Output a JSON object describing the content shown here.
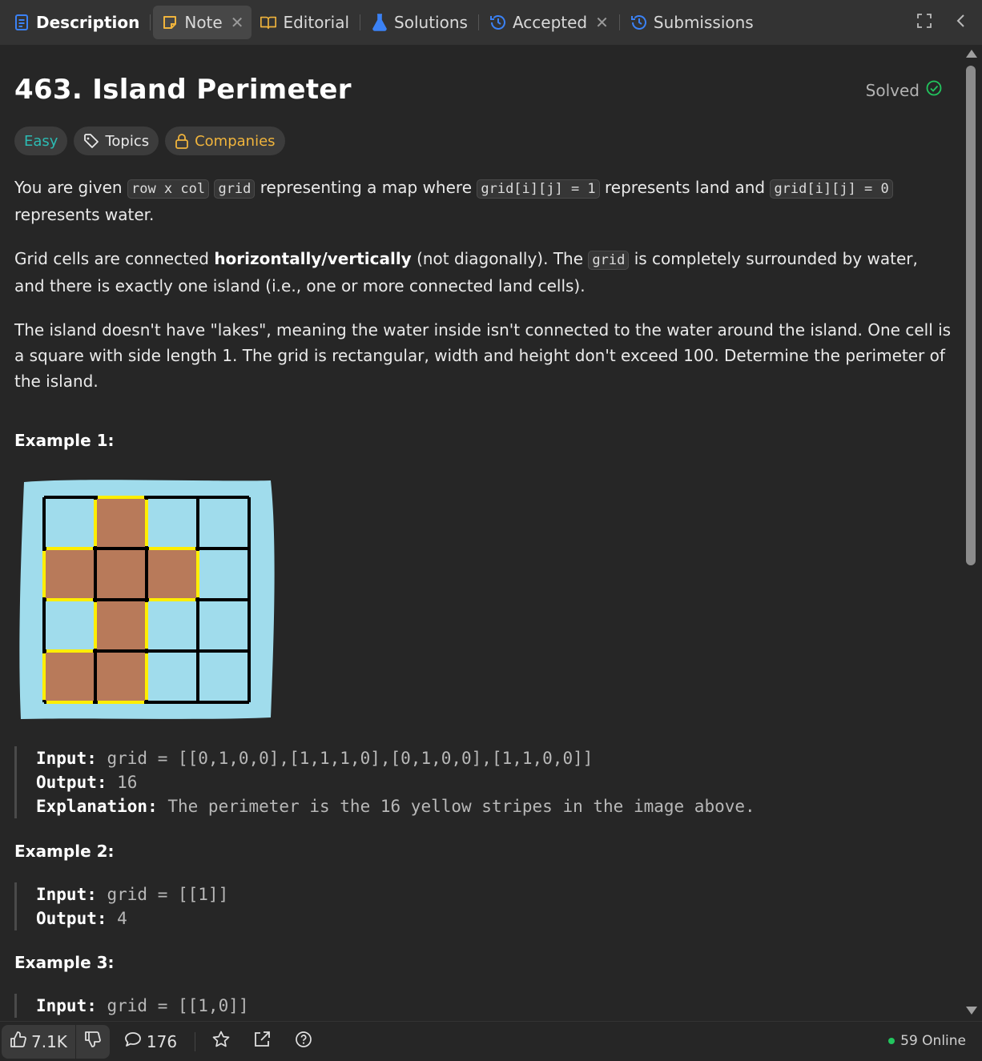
{
  "tabs": [
    {
      "label": "Description",
      "icon": "description-icon"
    },
    {
      "label": "Note",
      "icon": "note-icon",
      "closable": true
    },
    {
      "label": "Editorial",
      "icon": "book-icon"
    },
    {
      "label": "Solutions",
      "icon": "flask-icon"
    },
    {
      "label": "Accepted",
      "icon": "history-icon",
      "closable": true
    },
    {
      "label": "Submissions",
      "icon": "history-icon"
    }
  ],
  "problem": {
    "title": "463. Island Perimeter",
    "status": "Solved",
    "difficulty": "Easy",
    "topics_label": "Topics",
    "companies_label": "Companies"
  },
  "description": {
    "p1_a": "You are given ",
    "p1_code1": "row x col",
    "p1_code2": "grid",
    "p1_b": " representing a map where ",
    "p1_code3": "grid[i][j] = 1",
    "p1_c": " represents land and ",
    "p1_code4": "grid[i][j] = 0",
    "p1_d": " represents water.",
    "p2_a": "Grid cells are connected ",
    "p2_bold": "horizontally/vertically",
    "p2_b": " (not diagonally). The ",
    "p2_code": "grid",
    "p2_c": " is completely surrounded by water, and there is exactly one island (i.e., one or more connected land cells).",
    "p3": "The island doesn't have \"lakes\", meaning the water inside isn't connected to the water around the island. One cell is a square with side length 1. The grid is rectangular, width and height don't exceed 100. Determine the perimeter of the island."
  },
  "examples": [
    {
      "title": "Example 1:",
      "input_label": "Input:",
      "input": " grid = [[0,1,0,0],[1,1,1,0],[0,1,0,0],[1,1,0,0]]",
      "output_label": "Output:",
      "output": " 16",
      "explanation_label": "Explanation:",
      "explanation": " The perimeter is the 16 yellow stripes in the image above."
    },
    {
      "title": "Example 2:",
      "input_label": "Input:",
      "input": " grid = [[1]]",
      "output_label": "Output:",
      "output": " 4"
    },
    {
      "title": "Example 3:",
      "input_label": "Input:",
      "input": " grid = [[1,0]]"
    }
  ],
  "figure": {
    "grid": [
      [
        0,
        1,
        0,
        0
      ],
      [
        1,
        1,
        1,
        0
      ],
      [
        0,
        1,
        0,
        0
      ],
      [
        1,
        1,
        0,
        0
      ]
    ],
    "water_color": "#a0dcec",
    "land_color": "#b87a5a",
    "perimeter_color": "#ffee00"
  },
  "footer": {
    "likes": "7.1K",
    "comments": "176",
    "online": "59 Online"
  },
  "colors": {
    "accent_easy": "#2cbbb3",
    "accent_companies": "#f0b43c",
    "solved_check": "#22c55e",
    "tab_icon_blue": "#3b82f6",
    "note_icon": "#f0b43c"
  }
}
